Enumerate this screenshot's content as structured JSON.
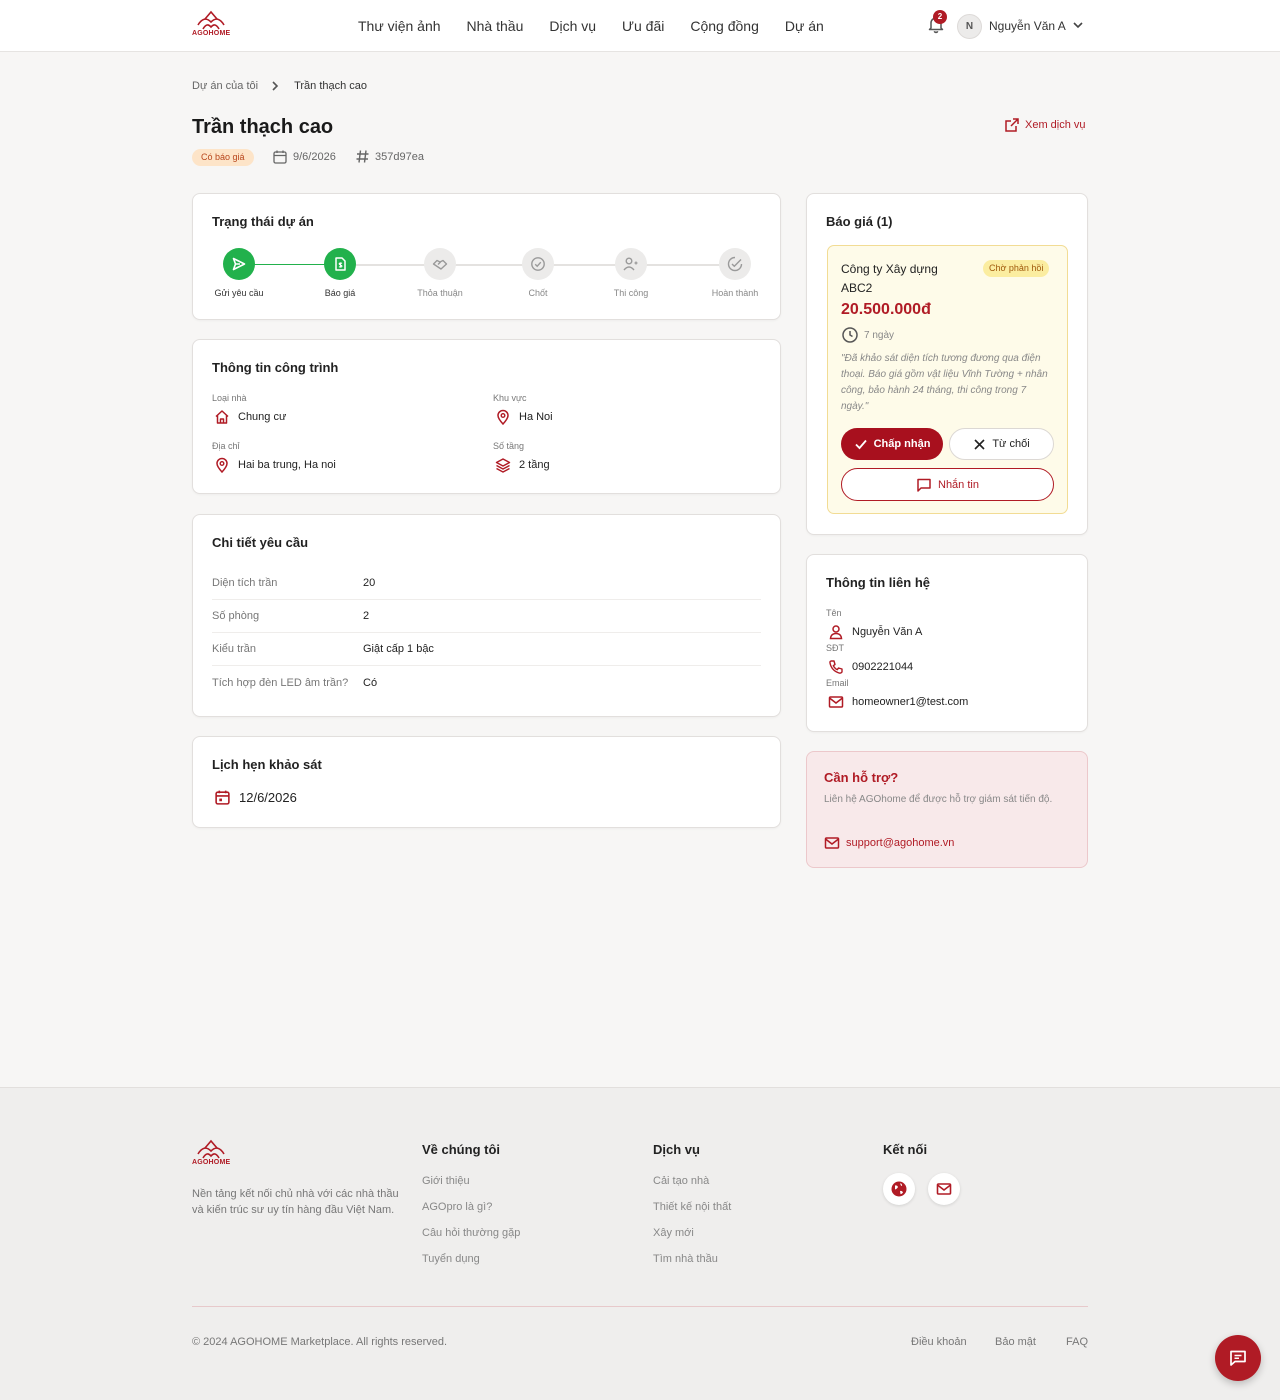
{
  "brand": {
    "name": "AGOHOME",
    "accent": "#b01b25",
    "success": "#22b14c"
  },
  "header": {
    "nav": [
      "Thư viện ảnh",
      "Nhà thầu",
      "Dịch vụ",
      "Ưu đãi",
      "Cộng đồng",
      "Dự án"
    ],
    "notification_count": "2",
    "avatar_initial": "N",
    "user_name": "Nguyễn Văn A"
  },
  "breadcrumb": {
    "parent": "Dự án của tôi",
    "current": "Trần thạch cao"
  },
  "project": {
    "title": "Trần thạch cao",
    "status": "Có báo giá",
    "date": "9/6/2026",
    "id": "357d97ea",
    "view_service": "Xem dịch vụ"
  },
  "status_card": {
    "title": "Trạng thái dự án",
    "steps": [
      {
        "label": "Gửi yêu cầu",
        "icon": "send-icon",
        "done": true
      },
      {
        "label": "Báo giá",
        "icon": "quote-document-icon",
        "done": true
      },
      {
        "label": "Thỏa thuận",
        "icon": "handshake-icon",
        "done": false
      },
      {
        "label": "Chốt",
        "icon": "check-circle-icon",
        "done": false
      },
      {
        "label": "Thi công",
        "icon": "worker-icon",
        "done": false
      },
      {
        "label": "Hoàn thành",
        "icon": "check-badge-icon",
        "done": false
      }
    ]
  },
  "building_info": {
    "title": "Thông tin công trình",
    "house_type_label": "Loại nhà",
    "house_type": "Chung cư",
    "area_label": "Khu vực",
    "area": "Ha Noi",
    "address_label": "Địa chỉ",
    "address": "Hai ba trung, Ha noi",
    "floors_label": "Số tầng",
    "floors": "2 tầng"
  },
  "request_details": {
    "title": "Chi tiết yêu cầu",
    "rows": [
      {
        "key": "Diện tích trần",
        "value": "20"
      },
      {
        "key": "Số phòng",
        "value": "2"
      },
      {
        "key": "Kiểu trần",
        "value": "Giật cấp 1 bậc"
      },
      {
        "key": "Tích hợp đèn LED âm trần?",
        "value": "Có"
      }
    ]
  },
  "survey": {
    "title": "Lịch hẹn khảo sát",
    "date": "12/6/2026"
  },
  "quotes": {
    "title": "Báo giá (1)",
    "items": [
      {
        "company": "Công ty Xây dựng ABC2",
        "status": "Chờ phản hồi",
        "price": "20.500.000đ",
        "duration": "7 ngày",
        "note": "\"Đã khảo sát diện tích tương đương qua điện thoại. Báo giá gồm vật liệu Vĩnh Tường + nhân công, bảo hành 24 tháng, thi công trong 7 ngày.\"",
        "accept_label": "Chấp nhận",
        "reject_label": "Từ chối",
        "message_label": "Nhắn tin"
      }
    ]
  },
  "contact": {
    "title": "Thông tin liên hệ",
    "name_label": "Tên",
    "name": "Nguyễn Văn A",
    "phone_label": "SĐT",
    "phone": "0902221044",
    "email_label": "Email",
    "email": "homeowner1@test.com"
  },
  "support": {
    "title": "Cần hỗ trợ?",
    "text": "Liên hệ AGOhome để được hỗ trợ giám sát tiến độ.",
    "email": "support@agohome.vn"
  },
  "footer": {
    "description": "Nền tảng kết nối chủ nhà với các nhà thầu và kiến trúc sư uy tín hàng đầu Việt Nam.",
    "about_title": "Về chúng tôi",
    "about_links": [
      "Giới thiệu",
      "AGOpro là gì?",
      "Câu hỏi thường gặp",
      "Tuyển dụng"
    ],
    "services_title": "Dịch vụ",
    "services_links": [
      "Cải tạo nhà",
      "Thiết kế nội thất",
      "Xây mới",
      "Tìm nhà thầu"
    ],
    "connect_title": "Kết nối",
    "copyright": "© 2024 AGOHOME Marketplace. All rights reserved.",
    "legal_links": [
      "Điều khoản",
      "Bảo mật",
      "FAQ"
    ]
  }
}
